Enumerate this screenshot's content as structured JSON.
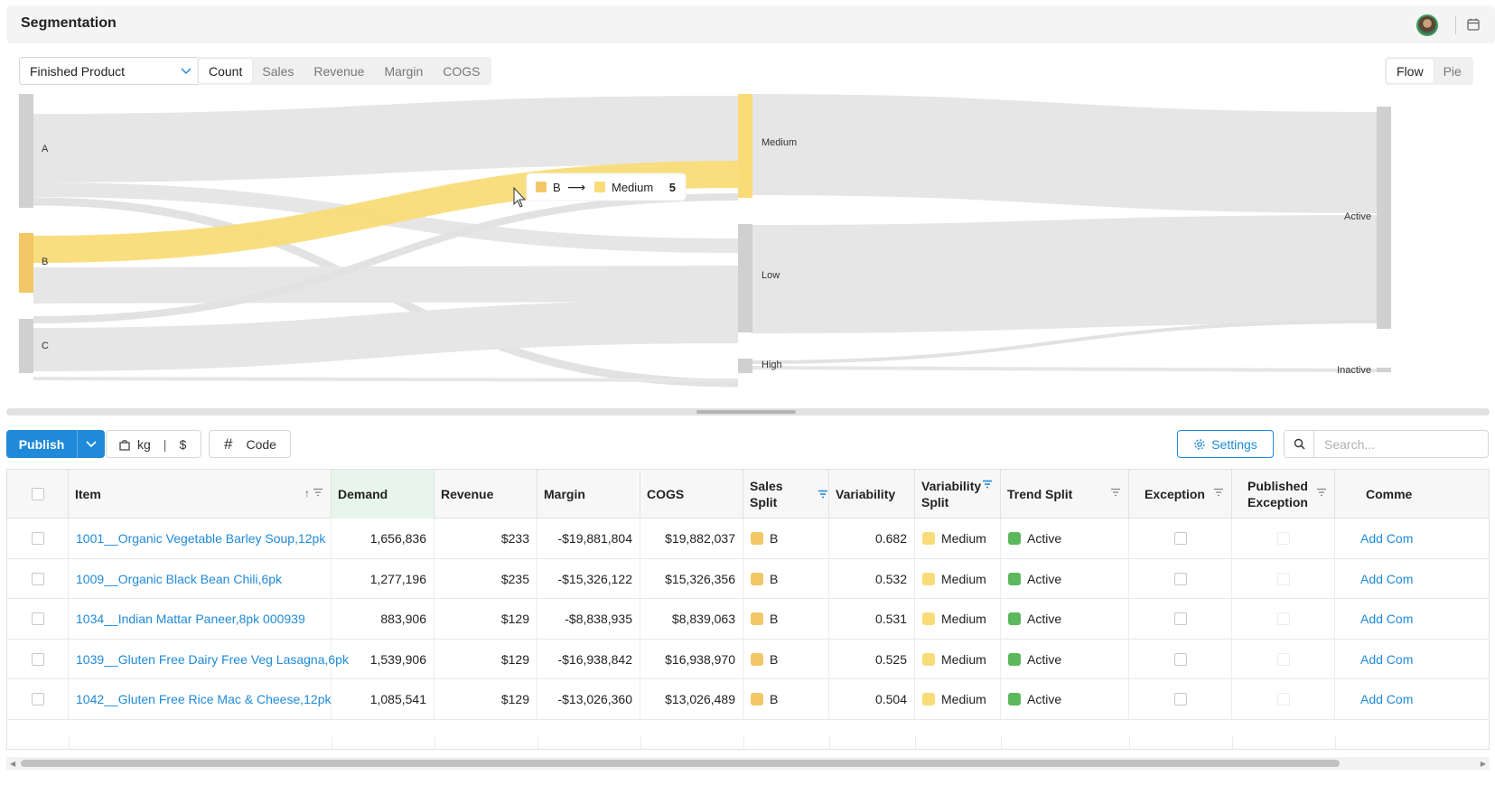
{
  "header": {
    "title": "Segmentation"
  },
  "toolbar": {
    "dropdown_value": "Finished Product",
    "metric_tabs": [
      "Count",
      "Sales",
      "Revenue",
      "Margin",
      "COGS"
    ],
    "active_metric": "Count",
    "view_tabs": [
      "Flow",
      "Pie"
    ],
    "active_view": "Flow"
  },
  "sankey": {
    "left_nodes": [
      "A",
      "B",
      "C"
    ],
    "middle_nodes": [
      "Medium",
      "Low",
      "High"
    ],
    "right_nodes": [
      "Active",
      "Inactive"
    ],
    "tooltip": {
      "from": "B",
      "arrow": "⟶",
      "to": "Medium",
      "value": "5"
    },
    "colors": {
      "B": "#f2c765",
      "Medium": "#f9dc78",
      "neutral": "#e6e6e6",
      "node": "#cfcfcf"
    }
  },
  "actions": {
    "publish_label": "Publish",
    "unit_kg": "kg",
    "unit_sep": "|",
    "unit_currency": "$",
    "code_label": "Code",
    "settings_label": "Settings",
    "search_placeholder": "Search..."
  },
  "table": {
    "columns": [
      "Item",
      "Demand",
      "Revenue",
      "Margin",
      "COGS",
      "Sales Split",
      "Variability",
      "Variability Split",
      "Trend Split",
      "Exception",
      "Published Exception",
      "Comme"
    ],
    "rows": [
      {
        "item": "1001__Organic Vegetable Barley Soup,12pk",
        "demand": "1,656,836",
        "revenue": "$233",
        "margin": "-$19,881,804",
        "cogs": "$19,882,037",
        "sales_split": "B",
        "variability": "0.682",
        "variability_split": "Medium",
        "trend_split": "Active",
        "comment": "Add Com"
      },
      {
        "item": "1009__Organic Black Bean Chili,6pk",
        "demand": "1,277,196",
        "revenue": "$235",
        "margin": "-$15,326,122",
        "cogs": "$15,326,356",
        "sales_split": "B",
        "variability": "0.532",
        "variability_split": "Medium",
        "trend_split": "Active",
        "comment": "Add Com"
      },
      {
        "item": "1034__Indian Mattar Paneer,8pk 000939",
        "demand": "883,906",
        "revenue": "$129",
        "margin": "-$8,838,935",
        "cogs": "$8,839,063",
        "sales_split": "B",
        "variability": "0.531",
        "variability_split": "Medium",
        "trend_split": "Active",
        "comment": "Add Com"
      },
      {
        "item": "1039__Gluten Free Dairy Free Veg Lasagna,6pk",
        "demand": "1,539,906",
        "revenue": "$129",
        "margin": "-$16,938,842",
        "cogs": "$16,938,970",
        "sales_split": "B",
        "variability": "0.525",
        "variability_split": "Medium",
        "trend_split": "Active",
        "comment": "Add Com"
      },
      {
        "item": "1042__Gluten Free Rice Mac & Cheese,12pk",
        "demand": "1,085,541",
        "revenue": "$129",
        "margin": "-$13,026,360",
        "cogs": "$13,026,489",
        "sales_split": "B",
        "variability": "0.504",
        "variability_split": "Medium",
        "trend_split": "Active",
        "comment": "Add Com"
      }
    ],
    "swatch_colors": {
      "B": "#f2c765",
      "Medium": "#f9dc78",
      "Active": "#5cb85c"
    }
  }
}
